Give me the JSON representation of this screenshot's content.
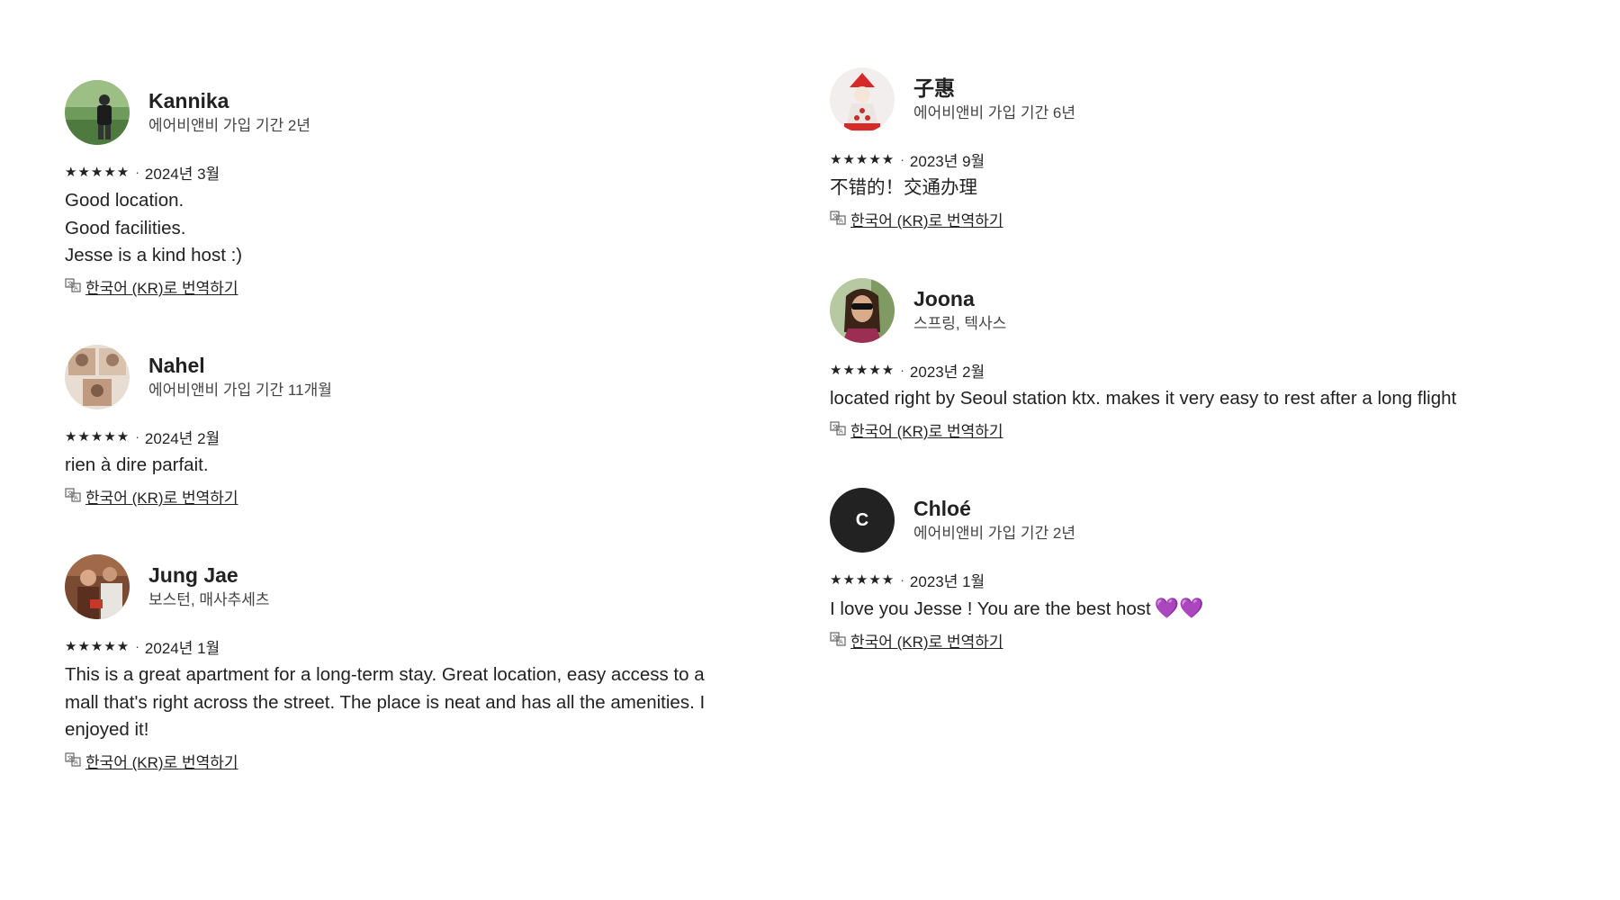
{
  "left_column": [
    {
      "name": "Kannika",
      "subtitle": "에어비앤비 가입 기간 2년",
      "stars": "★★★★★",
      "date": "2024년 3월",
      "text": "Good location.\nGood facilities.\nJesse is a kind host :)",
      "translate": "한국어 (KR)로 번역하기",
      "avatar": "photo-person-outdoors"
    },
    {
      "name": "Nahel",
      "subtitle": "에어비앤비 가입 기간 11개월",
      "stars": "★★★★★",
      "date": "2024년 2월",
      "text": "rien à dire parfait.",
      "translate": "한국어 (KR)로 번역하기",
      "avatar": "photo-collage"
    },
    {
      "name": "Jung Jae",
      "subtitle": "보스턴, 매사추세츠",
      "stars": "★★★★★",
      "date": "2024년 1월",
      "text": "This is a great apartment for a long-term stay. Great location, easy access to a\nmall that's right across the street. The place is neat and has all the amenities. I\nenjoyed it!",
      "translate": "한국어 (KR)로 번역하기",
      "avatar": "photo-people"
    }
  ],
  "right_column": [
    {
      "name": "子惠",
      "subtitle": "에어비앤비 가입 기간 6년",
      "stars": "★★★★★",
      "date": "2023년 9월",
      "text": "不错的！交通办理",
      "translate": "한국어 (KR)로 번역하기",
      "avatar": "photo-santa-figure"
    },
    {
      "name": "Joona",
      "subtitle": "스프링, 텍사스",
      "stars": "★★★★★",
      "date": "2023년 2월",
      "text": "located right by Seoul station ktx. makes it very easy to rest after a long flight",
      "translate": "한국어 (KR)로 번역하기",
      "avatar": "photo-woman-sunglasses"
    },
    {
      "name": "Chloé",
      "subtitle": "에어비앤비 가입 기간 2년",
      "stars": "★★★★★",
      "date": "2023년 1월",
      "text": "I love you Jesse ! You are the best host",
      "hearts": "💜💜",
      "translate": "한국어 (KR)로 번역하기",
      "avatar_letter": "C",
      "avatar": "letter-avatar"
    }
  ],
  "separator": "·",
  "colors": {
    "text": "#222222",
    "subtext": "#444444",
    "heart": "#7b5cd6",
    "letter_avatar_bg": "#222222"
  }
}
